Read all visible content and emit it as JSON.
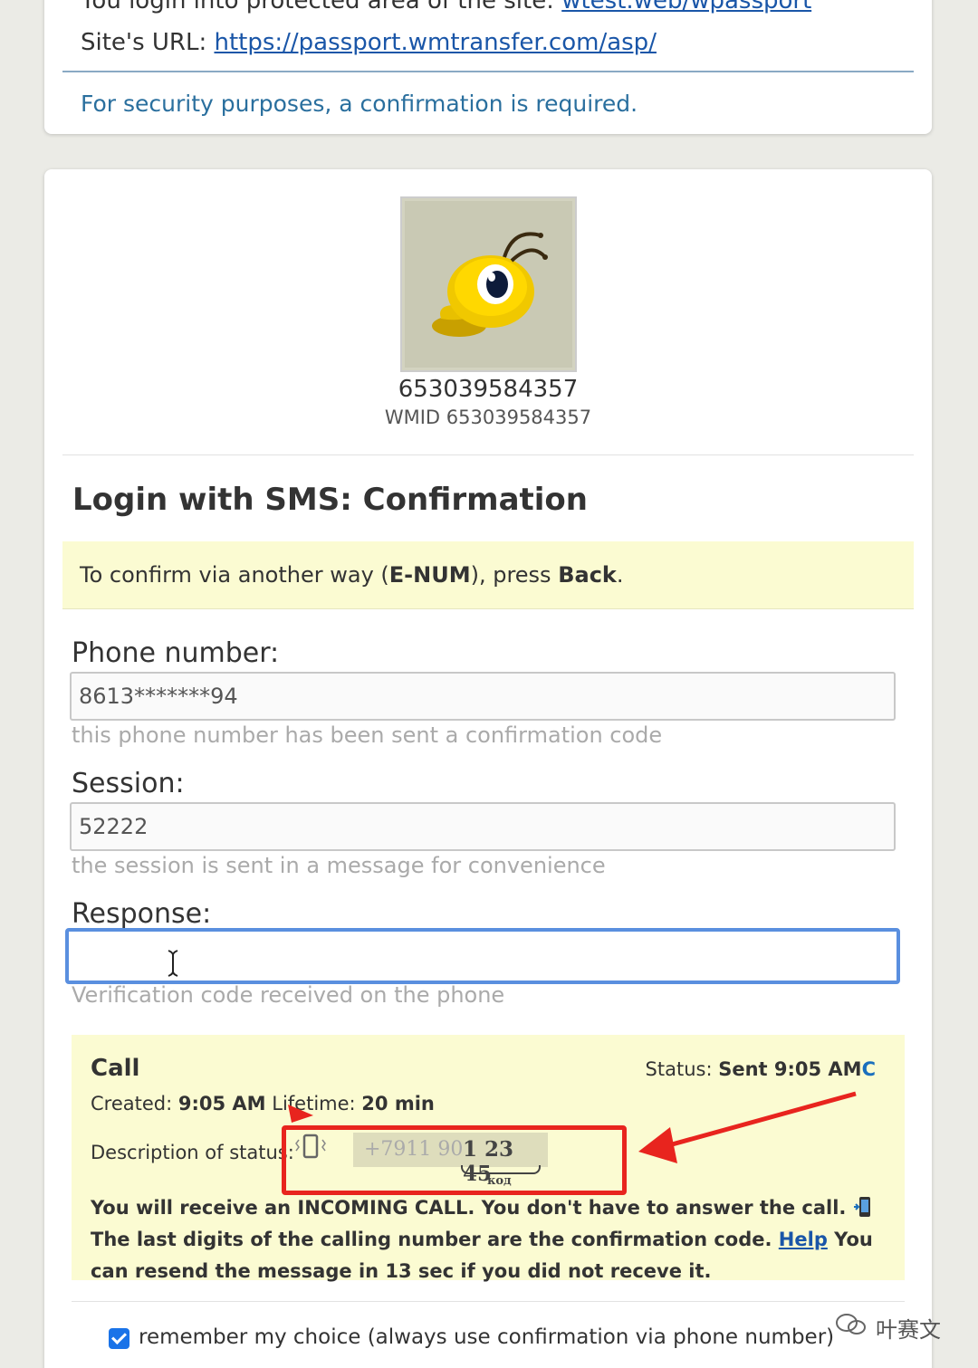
{
  "top_card": {
    "clipped_line_start": "You login into protected area of the site: ",
    "clipped_line_link": "wtest.web/wpassport",
    "site_url_label": "Site's URL: ",
    "site_url": "https://passport.wmtransfer.com/asp/",
    "security_note": "For security purposes, a confirmation is required."
  },
  "user": {
    "number": "653039584357",
    "wmid": "WMID 653039584357"
  },
  "page_title": "Login with SMS: Confirmation",
  "alt_note": {
    "prefix": "To confirm via another way (",
    "method": "E-NUM",
    "middle": "), press ",
    "action": "Back",
    "suffix": "."
  },
  "phone": {
    "label": "Phone number:",
    "value": "8613*******94",
    "hint": "this phone number has been sent a confirmation code"
  },
  "session": {
    "label": "Session:",
    "value": "52222",
    "hint": "the session is sent in a message for convenience"
  },
  "response": {
    "label": "Response:",
    "value": "",
    "hint": "Verification code received on the phone"
  },
  "call": {
    "title": "Call",
    "status_label": "Status: ",
    "status_value": "Sent 9:05 AM",
    "refresh_icon": "C",
    "created_label": "Created: ",
    "created_value": "9:05 AM",
    "lifetime_label": " Lifetime: ",
    "lifetime_value": "20 min",
    "desc_label": "Description of status: ",
    "phone_prefix": "+7911 90",
    "phone_code": "1 23 45",
    "code_label": "код",
    "text_1": "You will receive an INCOMING CALL. You don't have to answer the call. ",
    "text_2": " The last digits of the calling number are the confirmation code. ",
    "help_link": "Help",
    "text_3": " You can resend the message in 13 sec if you did not receve it."
  },
  "remember": {
    "checked": true,
    "label": "remember my choice (always use confirmation via phone number)"
  },
  "watermark": "叶赛文",
  "colors": {
    "link": "#1a56a8",
    "note_bg": "#fbfbd2",
    "annotation": "#e8241e",
    "focus": "#5a8fdf"
  }
}
